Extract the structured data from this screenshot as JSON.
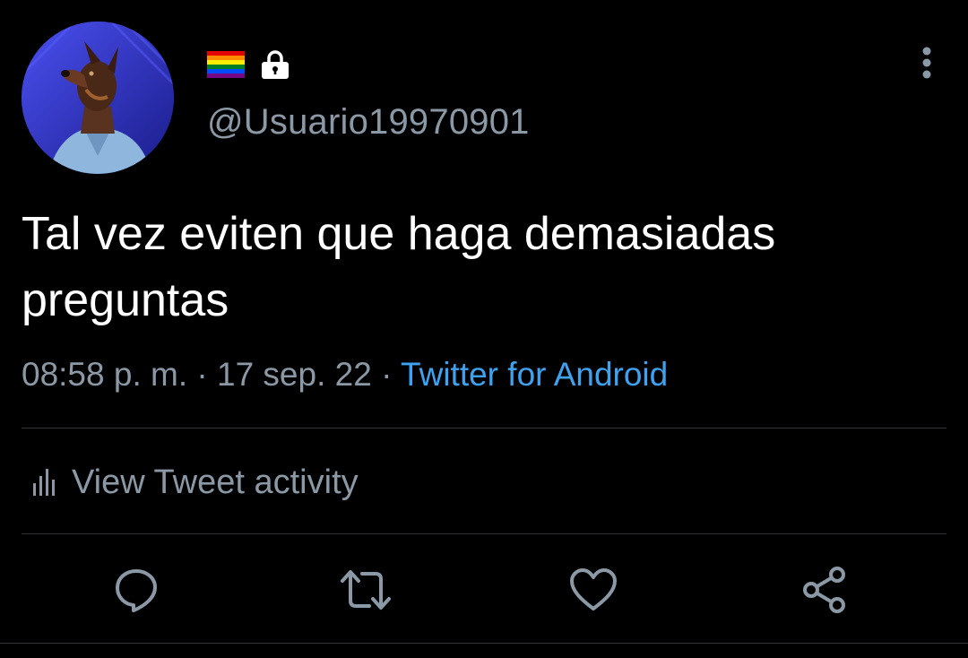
{
  "tweet": {
    "author": {
      "handle": "@Usuario19970901",
      "avatar_icon": "avatar-doberman-in-shirt",
      "name_icons": [
        "rainbow-flag-icon",
        "lock-icon"
      ]
    },
    "text": "Tal vez eviten que haga demasiadas preguntas",
    "meta": {
      "time": "08:58 p. m.",
      "separator": "·",
      "date": "17 sep. 22",
      "source": "Twitter for Android"
    },
    "activity": {
      "label": "View Tweet activity",
      "icon": "bar-chart-icon"
    },
    "actions": [
      {
        "name": "reply",
        "icon": "reply-icon"
      },
      {
        "name": "retweet",
        "icon": "retweet-icon"
      },
      {
        "name": "like",
        "icon": "heart-icon"
      },
      {
        "name": "share",
        "icon": "share-icon"
      }
    ],
    "more_icon": "more-vertical-icon"
  },
  "colors": {
    "background": "#000000",
    "text_primary": "#ffffff",
    "text_secondary": "#8b98a5",
    "link": "#3ea2f0",
    "divider": "#2f3336"
  }
}
